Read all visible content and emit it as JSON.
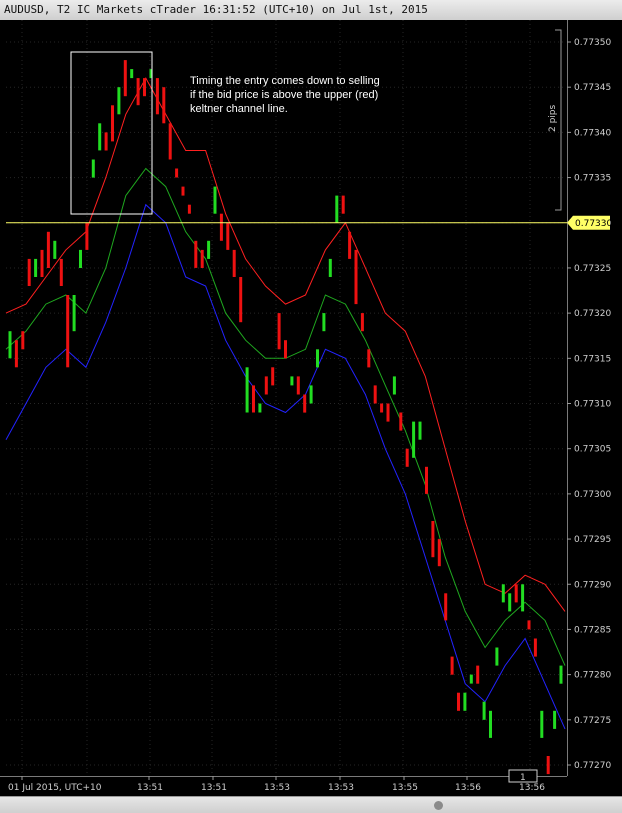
{
  "window": {
    "title": "AUDUSD, T2 IC Markets cTrader 16:31:52 (UTC+10) on Jul 1st, 2015"
  },
  "chart_data": {
    "type": "candlestick",
    "symbol": "AUDUSD",
    "timeframe": "T2",
    "ylim": [
      0.77268,
      0.77352
    ],
    "yticks": [
      "0.77350",
      "0.77345",
      "0.77340",
      "0.77335",
      "0.77330",
      "0.77325",
      "0.77320",
      "0.77315",
      "0.77310",
      "0.77305",
      "0.77300",
      "0.77295",
      "0.77290",
      "0.77285",
      "0.77280",
      "0.77275",
      "0.77270"
    ],
    "xticks": [
      "01 Jul 2015, UTC+10",
      "13:51",
      "13:51",
      "13:53",
      "13:53",
      "13:55",
      "13:56",
      "13:56"
    ],
    "current_price_label": "0.77330",
    "current_price": 0.7733,
    "scale_label": "2 pips",
    "annotation": "Timing the entry comes down to selling if the bid price is above the upper (red) keltner channel line.",
    "annotation_lines": [
      "Timing the entry comes down to selling",
      "if the bid price is above the upper (red)",
      "keltner channel line."
    ],
    "marker_label": "1",
    "colors": {
      "up": "#22dd22",
      "down": "#ee1111",
      "upper_band": "#ff2020",
      "middle_band": "#1fa81f",
      "lower_band": "#2323ff",
      "price_line": "#ffff66"
    },
    "keltner": {
      "upper": [
        0.7732,
        0.77321,
        0.77324,
        0.77327,
        0.77329,
        0.77335,
        0.77342,
        0.77346,
        0.77342,
        0.77338,
        0.77338,
        0.77331,
        0.77326,
        0.77323,
        0.77321,
        0.77322,
        0.77327,
        0.7733,
        0.77325,
        0.7732,
        0.77318,
        0.77313,
        0.77305,
        0.77297,
        0.7729,
        0.77289,
        0.77291,
        0.7729,
        0.77287
      ],
      "middle": [
        0.77316,
        0.77318,
        0.77321,
        0.77322,
        0.7732,
        0.77325,
        0.77333,
        0.77336,
        0.77334,
        0.77329,
        0.77326,
        0.7732,
        0.77317,
        0.77315,
        0.77315,
        0.77316,
        0.77322,
        0.77321,
        0.77317,
        0.77312,
        0.77307,
        0.77301,
        0.77293,
        0.77287,
        0.77283,
        0.77286,
        0.77288,
        0.77286,
        0.77281
      ],
      "lower": [
        0.77306,
        0.7731,
        0.77314,
        0.77316,
        0.77314,
        0.77319,
        0.77325,
        0.77332,
        0.7733,
        0.77324,
        0.77323,
        0.77317,
        0.77313,
        0.7731,
        0.77309,
        0.77311,
        0.77316,
        0.77315,
        0.77311,
        0.77305,
        0.773,
        0.77293,
        0.77286,
        0.77279,
        0.77277,
        0.77281,
        0.77284,
        0.77279,
        0.77274
      ]
    },
    "candles": [
      [
        0.77315,
        0.77318,
        1
      ],
      [
        0.77314,
        0.77317,
        0
      ],
      [
        0.77318,
        0.77316,
        0
      ],
      [
        0.77326,
        0.77323,
        0
      ],
      [
        0.77324,
        0.77326,
        1
      ],
      [
        0.77327,
        0.77324,
        0
      ],
      [
        0.77329,
        0.77325,
        0
      ],
      [
        0.77328,
        0.77326,
        1
      ],
      [
        0.77326,
        0.77323,
        0
      ],
      [
        0.77322,
        0.77314,
        0
      ],
      [
        0.77318,
        0.77322,
        1
      ],
      [
        0.77325,
        0.77327,
        1
      ],
      [
        0.7733,
        0.77327,
        0
      ],
      [
        0.77335,
        0.77337,
        1
      ],
      [
        0.77338,
        0.77341,
        1
      ],
      [
        0.7734,
        0.77338,
        0
      ],
      [
        0.77343,
        0.77339,
        0
      ],
      [
        0.77342,
        0.77345,
        1
      ],
      [
        0.77348,
        0.77344,
        0
      ],
      [
        0.77346,
        0.77347,
        1
      ],
      [
        0.77346,
        0.77343,
        0
      ],
      [
        0.77346,
        0.77344,
        0
      ],
      [
        0.77347,
        0.77346,
        1
      ],
      [
        0.77346,
        0.77342,
        0
      ],
      [
        0.77345,
        0.77341,
        0
      ],
      [
        0.77341,
        0.77337,
        0
      ],
      [
        0.77336,
        0.77335,
        0
      ],
      [
        0.77334,
        0.77333,
        0
      ],
      [
        0.77332,
        0.77331,
        0
      ],
      [
        0.77328,
        0.77325,
        0
      ],
      [
        0.77327,
        0.77325,
        0
      ],
      [
        0.77326,
        0.77328,
        1
      ],
      [
        0.77334,
        0.77331,
        1
      ],
      [
        0.77331,
        0.77328,
        0
      ],
      [
        0.7733,
        0.77327,
        0
      ],
      [
        0.77327,
        0.77324,
        0
      ],
      [
        0.77324,
        0.77319,
        0
      ],
      [
        0.77314,
        0.77309,
        1
      ],
      [
        0.77312,
        0.77309,
        0
      ],
      [
        0.7731,
        0.77309,
        1
      ],
      [
        0.77313,
        0.77311,
        0
      ],
      [
        0.77314,
        0.77312,
        0
      ],
      [
        0.7732,
        0.77316,
        0
      ],
      [
        0.77317,
        0.77315,
        0
      ],
      [
        0.77313,
        0.77312,
        1
      ],
      [
        0.77313,
        0.77311,
        0
      ],
      [
        0.77311,
        0.77309,
        0
      ],
      [
        0.77312,
        0.7731,
        1
      ],
      [
        0.77316,
        0.77314,
        1
      ],
      [
        0.77318,
        0.7732,
        1
      ],
      [
        0.77326,
        0.77324,
        1
      ],
      [
        0.77333,
        0.7733,
        1
      ],
      [
        0.77333,
        0.77331,
        0
      ],
      [
        0.77329,
        0.77326,
        0
      ],
      [
        0.77327,
        0.77321,
        0
      ],
      [
        0.7732,
        0.77318,
        0
      ],
      [
        0.77316,
        0.77314,
        0
      ],
      [
        0.77312,
        0.7731,
        0
      ],
      [
        0.7731,
        0.77309,
        0
      ],
      [
        0.7731,
        0.77308,
        0
      ],
      [
        0.77311,
        0.77313,
        1
      ],
      [
        0.77309,
        0.77307,
        0
      ],
      [
        0.77305,
        0.77303,
        0
      ],
      [
        0.77308,
        0.77304,
        1
      ],
      [
        0.77306,
        0.77308,
        1
      ],
      [
        0.77303,
        0.773,
        0
      ],
      [
        0.77297,
        0.77293,
        0
      ],
      [
        0.77295,
        0.77292,
        0
      ],
      [
        0.77289,
        0.77286,
        0
      ],
      [
        0.77282,
        0.7728,
        0
      ],
      [
        0.77276,
        0.77278,
        0
      ],
      [
        0.77276,
        0.77278,
        1
      ],
      [
        0.77279,
        0.7728,
        1
      ],
      [
        0.77281,
        0.77279,
        0
      ],
      [
        0.77277,
        0.77275,
        1
      ],
      [
        0.77276,
        0.77273,
        1
      ],
      [
        0.77281,
        0.77283,
        1
      ],
      [
        0.7729,
        0.77288,
        1
      ],
      [
        0.77289,
        0.77287,
        1
      ],
      [
        0.7729,
        0.77288,
        0
      ],
      [
        0.7729,
        0.77287,
        1
      ],
      [
        0.77286,
        0.77285,
        0
      ],
      [
        0.77284,
        0.77282,
        0
      ],
      [
        0.77276,
        0.77273,
        1
      ],
      [
        0.77271,
        0.77269,
        0
      ],
      [
        0.77274,
        0.77276,
        1
      ],
      [
        0.77279,
        0.77281,
        1
      ]
    ]
  }
}
